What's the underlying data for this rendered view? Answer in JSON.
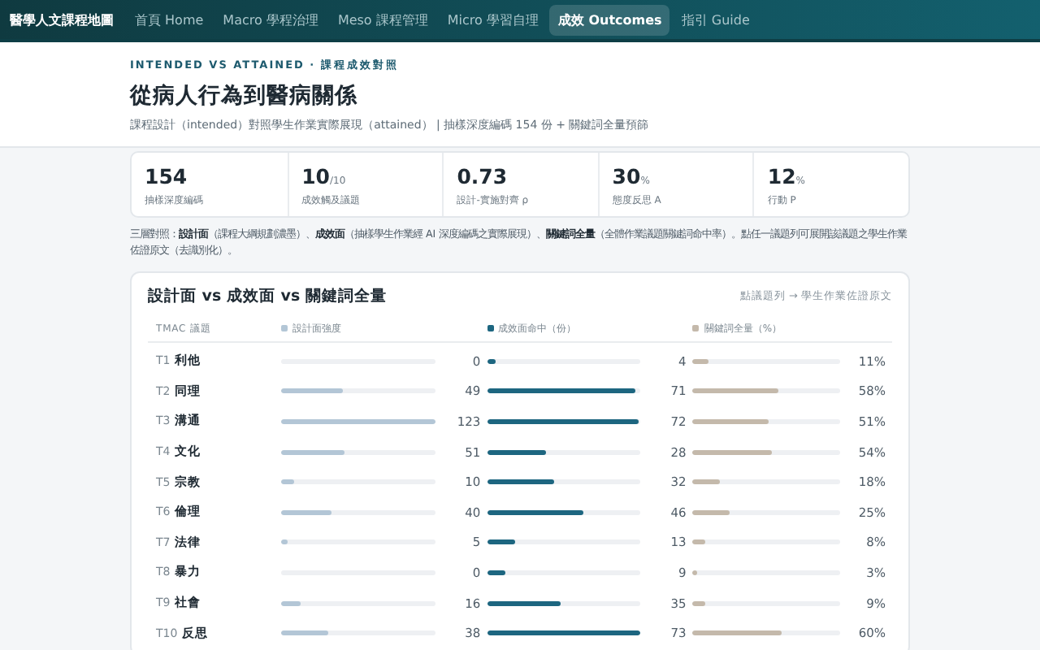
{
  "nav": {
    "brand": "醫學人文課程地圖",
    "items": [
      {
        "label": "首頁 Home",
        "selected": false
      },
      {
        "label": "Macro 學程治理",
        "selected": false
      },
      {
        "label": "Meso 課程管理",
        "selected": false
      },
      {
        "label": "Micro 學習自理",
        "selected": false
      },
      {
        "label": "成效 Outcomes",
        "selected": true
      },
      {
        "label": "指引 Guide",
        "selected": false
      }
    ]
  },
  "header": {
    "eyebrow": "INTENDED VS ATTAINED · 課程成效對照",
    "title": "從病人行為到醫病關係",
    "subtitle": "課程設計（intended）對照學生作業實際展現（attained） | 抽樣深度編碼 154 份 + 關鍵詞全量預篩"
  },
  "stats": [
    {
      "value": "154",
      "label": "抽樣深度編碼"
    },
    {
      "value": "10",
      "unit": "/10",
      "label": "成效觸及議題"
    },
    {
      "value": "0.73",
      "label": "設計-實施對齊 ρ"
    },
    {
      "value": "30",
      "unit": "%",
      "label": "態度反思 A"
    },
    {
      "value": "12",
      "unit": "%",
      "label": "行動 P"
    }
  ],
  "note": "三層對照：**設計面**（課程大綱規劃濃墨）、**成效面**（抽樣學生作業經 AI 深度編碼之實際展現）、**關鍵詞全量**（全體作業議題關鍵詞命中率）。點任一議題列可展開該議題之學生作業佐證原文（去識別化）。",
  "chart": {
    "title": "設計面 vs 成效面 vs 關鍵詞全量",
    "hint": "點議題列 → 學生作業佐證原文",
    "label_header": "TMAC 議題",
    "columns": [
      {
        "label": "設計面強度",
        "color": "#b3c6d6"
      },
      {
        "label": "成效面命中（份）",
        "color": "#1d6680"
      },
      {
        "label": "關鍵詞全量（%）",
        "color": "#c4b9ab"
      }
    ],
    "rows": [
      {
        "code": "T1",
        "topic": "利他",
        "cells": [
          {
            "value": "0"
          },
          {
            "value": "4",
            "level": 0.055
          },
          {
            "value": "11%",
            "level": 0.11
          }
        ]
      },
      {
        "code": "T2",
        "topic": "同理",
        "cells": [
          {
            "value": "49",
            "level": 0.4
          },
          {
            "value": "71",
            "level": 0.97
          },
          {
            "value": "58%",
            "level": 0.58
          }
        ]
      },
      {
        "code": "T3",
        "topic": "溝通",
        "cells": [
          {
            "value": "123",
            "level": 1
          },
          {
            "value": "72",
            "level": 0.99
          },
          {
            "value": "51%",
            "level": 0.51
          }
        ]
      },
      {
        "code": "T4",
        "topic": "文化",
        "cells": [
          {
            "value": "51",
            "level": 0.41
          },
          {
            "value": "28",
            "level": 0.38
          },
          {
            "value": "54%",
            "level": 0.54
          }
        ]
      },
      {
        "code": "T5",
        "topic": "宗教",
        "cells": [
          {
            "value": "10",
            "level": 0.08
          },
          {
            "value": "32",
            "level": 0.44
          },
          {
            "value": "18%",
            "level": 0.18
          }
        ]
      },
      {
        "code": "T6",
        "topic": "倫理",
        "cells": [
          {
            "value": "40",
            "level": 0.33
          },
          {
            "value": "46",
            "level": 0.63
          },
          {
            "value": "25%",
            "level": 0.25
          }
        ]
      },
      {
        "code": "T7",
        "topic": "法律",
        "cells": [
          {
            "value": "5",
            "level": 0.04
          },
          {
            "value": "13",
            "level": 0.18
          },
          {
            "value": "8%",
            "level": 0.08
          }
        ]
      },
      {
        "code": "T8",
        "topic": "暴力",
        "cells": [
          {
            "value": "0"
          },
          {
            "value": "9",
            "level": 0.12
          },
          {
            "value": "3%",
            "level": 0.03
          }
        ]
      },
      {
        "code": "T9",
        "topic": "社會",
        "cells": [
          {
            "value": "16",
            "level": 0.13
          },
          {
            "value": "35",
            "level": 0.48
          },
          {
            "value": "9%",
            "level": 0.09
          }
        ]
      },
      {
        "code": "T10",
        "topic": "反思",
        "cells": [
          {
            "value": "38",
            "level": 0.31
          },
          {
            "value": "73",
            "level": 1
          },
          {
            "value": "60%",
            "level": 0.6
          }
        ]
      }
    ]
  }
}
